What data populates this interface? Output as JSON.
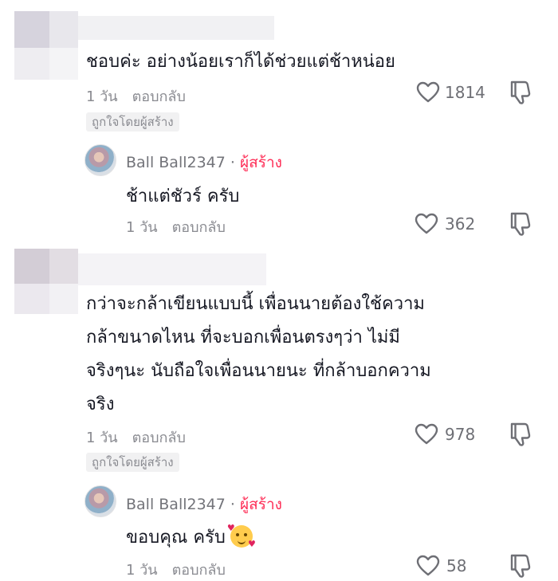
{
  "comments": [
    {
      "text_lines": [
        "ชอบค่ะ อย่างน้อยเราก็ได้ช่วยแต่ช้าหน่อย"
      ],
      "time": "1 วัน",
      "reply_label": "ตอบกลับ",
      "likes": "1814",
      "badge": "ถูกใจโดยผู้สร้าง",
      "reply": {
        "author": "Ball Ball2347",
        "separator": "·",
        "creator_label": "ผู้สร้าง",
        "text": "ช้าแต่ชัวร์ ครับ",
        "time": "1 วัน",
        "reply_label": "ตอบกลับ",
        "likes": "362"
      }
    },
    {
      "text_lines": [
        "กว่าจะกล้าเขียนแบบนี้ เพื่อนนายต้องใช้ความ",
        "กล้าขนาดไหน ที่จะบอกเพื่อนตรงๆว่า ไม่มี",
        "จริงๆนะ นับถือใจเพื่อนนายนะ ที่กล้าบอกความ",
        "จริง"
      ],
      "time": "1 วัน",
      "reply_label": "ตอบกลับ",
      "likes": "978",
      "badge": "ถูกใจโดยผู้สร้าง",
      "reply": {
        "author": "Ball Ball2347",
        "separator": "·",
        "creator_label": "ผู้สร้าง",
        "text": "ขอบคุณ ครับ",
        "emoji": "smiling-face-with-hearts",
        "time": "1 วัน",
        "reply_label": "ตอบกลับ",
        "likes": "58"
      }
    }
  ],
  "colors": {
    "text": "#161823",
    "muted": "#8a8b91",
    "creator": "#fe2c55",
    "badge_bg": "#f1f1f2"
  },
  "icons": {
    "like": "heart-outline-icon",
    "dislike": "thumbs-down-outline-icon"
  }
}
